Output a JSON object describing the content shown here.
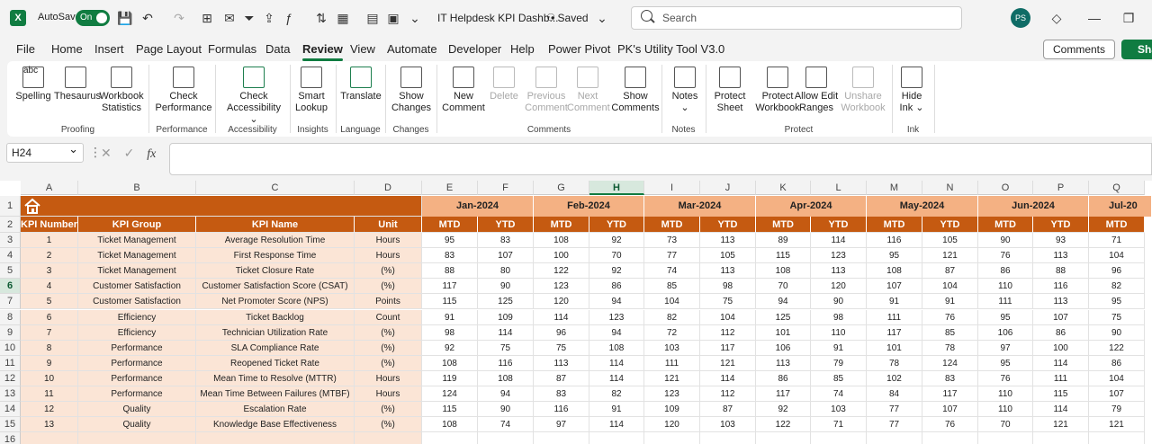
{
  "titlebar": {
    "autosave_label": "AutoSave",
    "autosave_state": "On",
    "doc_title": "IT Helpdesk KPI Dashb...",
    "saved_label": "• Saved",
    "search_placeholder": "Search",
    "avatar_initials": "PS"
  },
  "menu": [
    "File",
    "Home",
    "Insert",
    "Page Layout",
    "Formulas",
    "Data",
    "Review",
    "View",
    "Automate",
    "Developer",
    "Help",
    "Power Pivot",
    "PK's Utility Tool V3.0"
  ],
  "menu_active": "Review",
  "comments_btn": "Comments",
  "share_btn": "Sha",
  "ribbon": {
    "buttons": [
      {
        "id": "spelling",
        "label": "Spelling",
        "enabled": true
      },
      {
        "id": "thesaurus",
        "label": "Thesaurus",
        "enabled": true
      },
      {
        "id": "workbook-statistics",
        "label": "Workbook Statistics",
        "enabled": true
      },
      {
        "id": "check-performance",
        "label": "Check Performance",
        "enabled": true
      },
      {
        "id": "check-accessibility",
        "label": "Check Accessibility ⌄",
        "enabled": true
      },
      {
        "id": "smart-lookup",
        "label": "Smart Lookup",
        "enabled": true
      },
      {
        "id": "translate",
        "label": "Translate",
        "enabled": true
      },
      {
        "id": "show-changes",
        "label": "Show Changes",
        "enabled": true
      },
      {
        "id": "new-comment",
        "label": "New Comment",
        "enabled": true
      },
      {
        "id": "delete",
        "label": "Delete",
        "enabled": false
      },
      {
        "id": "previous-comment",
        "label": "Previous Comment",
        "enabled": false
      },
      {
        "id": "next-comment",
        "label": "Next Comment",
        "enabled": false
      },
      {
        "id": "show-comments",
        "label": "Show Comments",
        "enabled": true
      },
      {
        "id": "notes",
        "label": "Notes ⌄",
        "enabled": true
      },
      {
        "id": "protect-sheet",
        "label": "Protect Sheet",
        "enabled": true
      },
      {
        "id": "protect-workbook",
        "label": "Protect Workbook",
        "enabled": true
      },
      {
        "id": "allow-edit-ranges",
        "label": "Allow Edit Ranges",
        "enabled": true
      },
      {
        "id": "unshare-workbook",
        "label": "Unshare Workbook",
        "enabled": false
      },
      {
        "id": "hide-ink",
        "label": "Hide Ink ⌄",
        "enabled": true
      }
    ],
    "groups": [
      "Proofing",
      "Performance",
      "Accessibility",
      "Insights",
      "Language",
      "Changes",
      "Comments",
      "Notes",
      "Protect",
      "Ink"
    ]
  },
  "formula_bar": {
    "name_box": "H24",
    "fx": "fx"
  },
  "sheet": {
    "columns": [
      "A",
      "B",
      "C",
      "D",
      "E",
      "F",
      "G",
      "H",
      "I",
      "J",
      "K",
      "L",
      "M",
      "N",
      "O",
      "P",
      "Q"
    ],
    "selected_column": "H",
    "selected_row": "6",
    "row_numbers": [
      "1",
      "2",
      "3",
      "4",
      "5",
      "6",
      "7",
      "8",
      "9",
      "10",
      "11",
      "12",
      "13",
      "14",
      "15",
      "16"
    ],
    "months": [
      "Jan-2024",
      "Feb-2024",
      "Mar-2024",
      "Apr-2024",
      "May-2024",
      "Jun-2024",
      "Jul-20"
    ],
    "headers": [
      "KPI Number",
      "KPI Group",
      "KPI Name",
      "Unit"
    ],
    "mtd_label": "MTD",
    "ytd_label": "YTD",
    "rows": [
      {
        "num": "1",
        "group": "Ticket Management",
        "name": "Average Resolution Time",
        "unit": "Hours",
        "vals": [
          "95",
          "83",
          "108",
          "92",
          "73",
          "113",
          "89",
          "114",
          "116",
          "105",
          "90",
          "93",
          "71"
        ]
      },
      {
        "num": "2",
        "group": "Ticket Management",
        "name": "First Response Time",
        "unit": "Hours",
        "vals": [
          "83",
          "107",
          "100",
          "70",
          "77",
          "105",
          "115",
          "123",
          "95",
          "121",
          "76",
          "113",
          "104"
        ]
      },
      {
        "num": "3",
        "group": "Ticket Management",
        "name": "Ticket Closure Rate",
        "unit": "(%)",
        "vals": [
          "88",
          "80",
          "122",
          "92",
          "74",
          "113",
          "108",
          "113",
          "108",
          "87",
          "86",
          "88",
          "96"
        ]
      },
      {
        "num": "4",
        "group": "Customer Satisfaction",
        "name": "Customer Satisfaction Score (CSAT)",
        "unit": "(%)",
        "vals": [
          "117",
          "90",
          "123",
          "86",
          "85",
          "98",
          "70",
          "120",
          "107",
          "104",
          "110",
          "116",
          "82"
        ]
      },
      {
        "num": "5",
        "group": "Customer Satisfaction",
        "name": "Net Promoter Score (NPS)",
        "unit": "Points",
        "vals": [
          "115",
          "125",
          "120",
          "94",
          "104",
          "75",
          "94",
          "90",
          "91",
          "91",
          "111",
          "113",
          "95"
        ]
      },
      {
        "num": "6",
        "group": "Efficiency",
        "name": "Ticket Backlog",
        "unit": "Count",
        "vals": [
          "91",
          "109",
          "114",
          "123",
          "82",
          "104",
          "125",
          "98",
          "111",
          "76",
          "95",
          "107",
          "75"
        ]
      },
      {
        "num": "7",
        "group": "Efficiency",
        "name": "Technician Utilization Rate",
        "unit": "(%)",
        "vals": [
          "98",
          "114",
          "96",
          "94",
          "72",
          "112",
          "101",
          "110",
          "117",
          "85",
          "106",
          "86",
          "90"
        ]
      },
      {
        "num": "8",
        "group": "Performance",
        "name": "SLA Compliance Rate",
        "unit": "(%)",
        "vals": [
          "92",
          "75",
          "75",
          "108",
          "103",
          "117",
          "106",
          "91",
          "101",
          "78",
          "97",
          "100",
          "122"
        ]
      },
      {
        "num": "9",
        "group": "Performance",
        "name": "Reopened Ticket Rate",
        "unit": "(%)",
        "vals": [
          "108",
          "116",
          "113",
          "114",
          "111",
          "121",
          "113",
          "79",
          "78",
          "124",
          "95",
          "114",
          "86"
        ]
      },
      {
        "num": "10",
        "group": "Performance",
        "name": "Mean Time to Resolve (MTTR)",
        "unit": "Hours",
        "vals": [
          "119",
          "108",
          "87",
          "114",
          "121",
          "114",
          "86",
          "85",
          "102",
          "83",
          "76",
          "111",
          "104"
        ]
      },
      {
        "num": "11",
        "group": "Performance",
        "name": "Mean Time Between Failures (MTBF)",
        "unit": "Hours",
        "vals": [
          "124",
          "94",
          "83",
          "82",
          "123",
          "112",
          "117",
          "74",
          "84",
          "117",
          "110",
          "115",
          "107"
        ]
      },
      {
        "num": "12",
        "group": "Quality",
        "name": "Escalation Rate",
        "unit": "(%)",
        "vals": [
          "115",
          "90",
          "116",
          "91",
          "109",
          "87",
          "92",
          "103",
          "77",
          "107",
          "110",
          "114",
          "79"
        ]
      },
      {
        "num": "13",
        "group": "Quality",
        "name": "Knowledge Base Effectiveness",
        "unit": "(%)",
        "vals": [
          "108",
          "74",
          "97",
          "114",
          "120",
          "103",
          "122",
          "71",
          "77",
          "76",
          "70",
          "121",
          "121"
        ]
      }
    ]
  }
}
